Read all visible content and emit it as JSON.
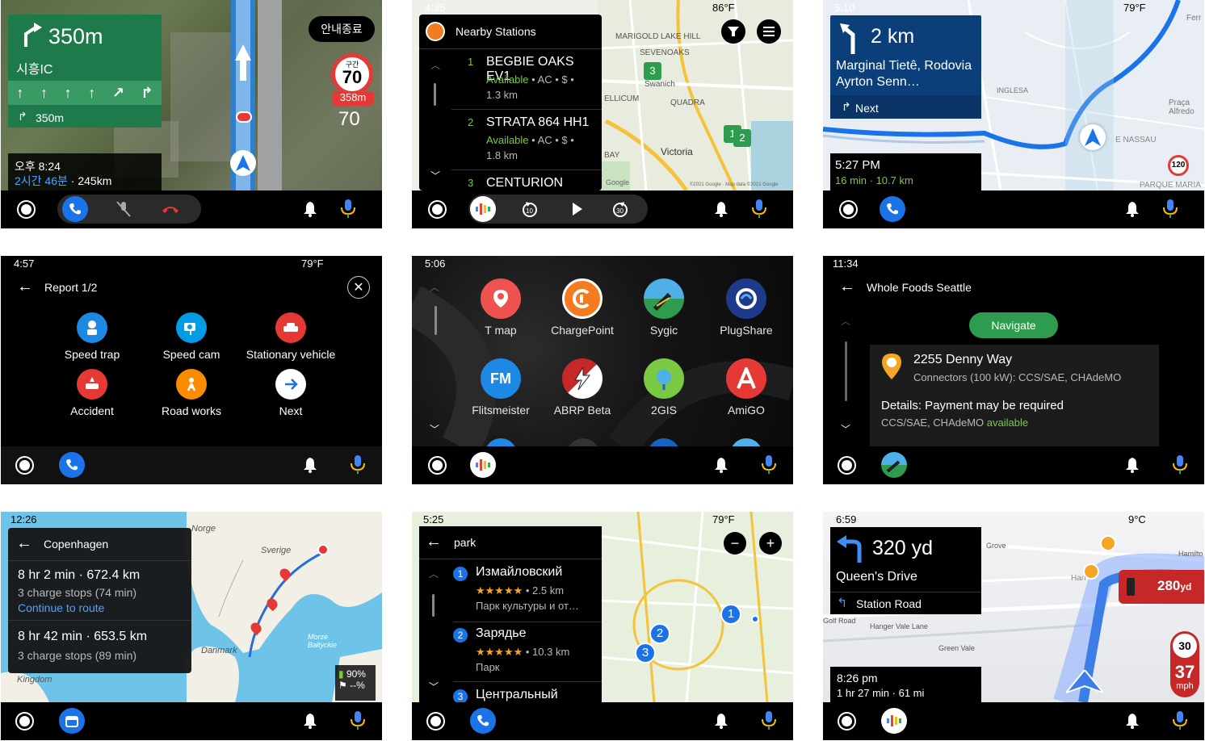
{
  "s1": {
    "distance": "350m",
    "road": "시흥IC",
    "next_dist": "350m",
    "exit_button": "안내종료",
    "speed_limit_label": "구간",
    "speed_limit": "70",
    "limit_dist": "358m",
    "current_speed": "70",
    "eta_time": "오후 8:24",
    "eta_remaining": "2시간 46분",
    "eta_distance": "245km"
  },
  "s2": {
    "time": "4:35",
    "weather": "86°F",
    "title": "Nearby Stations",
    "stations": [
      {
        "num": "1",
        "name": "BEGBIE OAKS EV1",
        "status": "Available",
        "details": " • AC • $ •",
        "dist": "1.3 km"
      },
      {
        "num": "2",
        "name": "STRATA 864 HH1",
        "status": "Available",
        "details": " • AC • $ •",
        "dist": "1.8 km"
      },
      {
        "num": "3",
        "name": "CENTURION",
        "status": "",
        "details": "",
        "dist": ""
      }
    ],
    "map_labels": [
      "MARIGOLD",
      "LAKE HILL",
      "SEVENOAKS",
      "Swanich",
      "QUADRA",
      "Victoria",
      "BAY",
      "ELLICUM"
    ],
    "markers": [
      "3",
      "1",
      "2"
    ],
    "attribution": "©2021 Google · Map data ©2021 Google",
    "google_logo": "Google",
    "rewind_label": "10",
    "forward_label": "30"
  },
  "s3": {
    "time": "5:10",
    "weather": "79°F",
    "distance": "2 km",
    "road": "Marginal Tietê, Rodovia Ayrton Senn…",
    "next_label": "Next",
    "eta_time": "5:27 PM",
    "eta_detail": "16 min · 10.7 km",
    "speed_sign": "120",
    "map_labels": [
      "INGLESA",
      "Praça Alfredo",
      "E NASSAU",
      "PARQUE MARIA",
      "Ferr"
    ]
  },
  "s4": {
    "time": "4:57",
    "weather": "79°F",
    "title": "Report 1/2",
    "items": [
      "Speed trap",
      "Speed cam",
      "Stationary vehicle",
      "Accident",
      "Road works",
      "Next"
    ]
  },
  "s5": {
    "time": "5:06",
    "apps": [
      "T map",
      "ChargePoint",
      "Sygic",
      "PlugShare",
      "Flitsmeister",
      "ABRP Beta",
      "2GIS",
      "AmiGO"
    ],
    "fm_icon_text": "FM"
  },
  "s6": {
    "time": "11:34",
    "title": "Whole Foods Seattle",
    "navigate": "Navigate",
    "address": "2255 Denny Way",
    "connectors": "Connectors (100 kW): CCS/SAE, CHAdeMO",
    "details": "Details: Payment may be required",
    "plugs": "CCS/SAE, CHAdeMO",
    "availability": "available"
  },
  "s7": {
    "time": "12:26",
    "title": "Copenhagen",
    "route1_main": "8 hr 2 min · 672.4 km",
    "route1_stops": "3 charge stops (74 min)",
    "route1_link": "Continue to route",
    "route2_main": "8 hr 42 min · 653.5 km",
    "route2_stops": "3 charge stops (89 min)",
    "battery": "90%",
    "battery2": "--%",
    "map_labels": [
      "Norge",
      "Sverige",
      "Danmark",
      "Kingdom",
      "Morze Bałtyckie"
    ]
  },
  "s8": {
    "time": "5:25",
    "weather": "79°F",
    "query": "park",
    "results": [
      {
        "num": "1",
        "name": "Измайловский",
        "stars": "★★★★★",
        "dist": " • 2.5 km",
        "type": "Парк культуры и от…"
      },
      {
        "num": "2",
        "name": "Зарядье",
        "stars": "★★★★★",
        "dist": " • 10.3 km",
        "type": "Парк"
      },
      {
        "num": "3",
        "name": "Центральный",
        "stars": "",
        "dist": "",
        "type": ""
      }
    ],
    "markers": [
      "1",
      "2",
      "3"
    ]
  },
  "s9": {
    "time": "6:59",
    "weather": "9°C",
    "distance": "320 yd",
    "road": "Queen's Drive",
    "next_road": "Station Road",
    "eta_time": "8:26 pm",
    "eta_detail": "1 hr 27 min · 61 mi",
    "camera_dist": "280",
    "camera_unit": "yd",
    "speed_limit": "30",
    "speed": "37",
    "speed_unit": "mph",
    "map_labels": [
      "Grove",
      "Hamilto",
      "Hanger Vale Lane",
      "Green Vale",
      "Golf Road",
      "Harr"
    ]
  },
  "colors": {
    "accent_blue": "#1a73e8",
    "nav_green": "#1e7a4a",
    "nav_blue": "#0b3f7a",
    "available_green": "#7ac943",
    "link_blue": "#4ea2ff"
  }
}
